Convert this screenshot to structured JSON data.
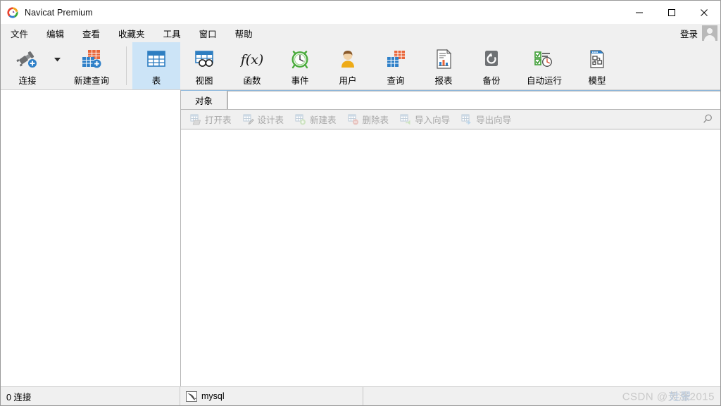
{
  "window": {
    "title": "Navicat Premium",
    "logo_icon": "navicat-logo-icon",
    "minimize_label": "—",
    "maximize_label": "□",
    "close_label": "✕"
  },
  "menubar": {
    "items": [
      {
        "label": "文件"
      },
      {
        "label": "编辑"
      },
      {
        "label": "查看"
      },
      {
        "label": "收藏夹"
      },
      {
        "label": "工具"
      },
      {
        "label": "窗口"
      },
      {
        "label": "帮助"
      }
    ],
    "login_label": "登录",
    "avatar_icon": "user-avatar-icon"
  },
  "ribbon": {
    "items": [
      {
        "label": "连接",
        "icon": "connection-plug-icon",
        "selected": false,
        "has_dropdown": true
      },
      {
        "label": "新建查询",
        "icon": "new-query-icon",
        "selected": false,
        "has_dropdown": false
      },
      {
        "label": "表",
        "icon": "table-icon",
        "selected": true,
        "has_dropdown": false
      },
      {
        "label": "视图",
        "icon": "view-icon",
        "selected": false,
        "has_dropdown": false
      },
      {
        "label": "函数",
        "icon": "function-fx-icon",
        "selected": false,
        "has_dropdown": false
      },
      {
        "label": "事件",
        "icon": "event-clock-icon",
        "selected": false,
        "has_dropdown": false
      },
      {
        "label": "用户",
        "icon": "user-icon",
        "selected": false,
        "has_dropdown": false
      },
      {
        "label": "查询",
        "icon": "query-icon",
        "selected": false,
        "has_dropdown": false
      },
      {
        "label": "报表",
        "icon": "report-icon",
        "selected": false,
        "has_dropdown": false
      },
      {
        "label": "备份",
        "icon": "backup-icon",
        "selected": false,
        "has_dropdown": false
      },
      {
        "label": "自动运行",
        "icon": "automation-icon",
        "selected": false,
        "has_dropdown": false
      },
      {
        "label": "模型",
        "icon": "model-icon",
        "selected": false,
        "has_dropdown": false
      }
    ]
  },
  "tabs": {
    "items": [
      {
        "label": "对象",
        "active": true
      }
    ]
  },
  "object_toolbar": {
    "buttons": [
      {
        "label": "打开表",
        "icon": "open-table-icon",
        "enabled": false
      },
      {
        "label": "设计表",
        "icon": "design-table-icon",
        "enabled": false
      },
      {
        "label": "新建表",
        "icon": "new-table-icon",
        "enabled": false
      },
      {
        "label": "删除表",
        "icon": "delete-table-icon",
        "enabled": false
      },
      {
        "label": "导入向导",
        "icon": "import-wizard-icon",
        "enabled": false
      },
      {
        "label": "导出向导",
        "icon": "export-wizard-icon",
        "enabled": false
      }
    ],
    "search_icon": "search-icon"
  },
  "sidebar": {
    "items": []
  },
  "statusbar": {
    "connections_text": "0 连接",
    "database_label": "mysql",
    "database_icon": "mysql-dolphin-icon",
    "watermark_prefix": "CSDN @",
    "watermark_name_a": "天涨",
    "watermark_name_b": "姓翚",
    "watermark_suffix": "2015"
  },
  "colors": {
    "accent_selected": "#cce4f7",
    "titlebar_bg": "#ffffff",
    "chrome_bg": "#f0f0f0",
    "border": "#b6b6b6",
    "disabled_text": "#a8a8a8",
    "table_blue": "#2e7ec1",
    "event_green": "#43a838",
    "user_gold": "#e8a318"
  }
}
